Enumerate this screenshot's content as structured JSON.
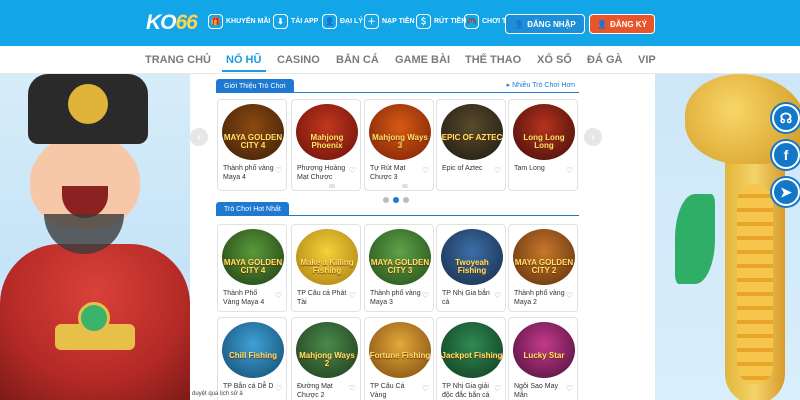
{
  "header": {
    "logo_main": "KO",
    "logo_num": "66",
    "quick_links": [
      {
        "label": "KHUYẾN MÃI",
        "icon": "gift-icon",
        "glyph": "🎁"
      },
      {
        "label": "TẢI APP",
        "icon": "download-icon",
        "glyph": "⬇"
      },
      {
        "label": "ĐẠI LÝ",
        "icon": "agent-icon",
        "glyph": "👤"
      },
      {
        "label": "NẠP TIỀN",
        "icon": "deposit-icon",
        "glyph": "＋"
      },
      {
        "label": "RÚT TIỀN",
        "icon": "withdraw-icon",
        "glyph": "＄"
      },
      {
        "label": "CHƠI THỬ",
        "icon": "gamepad-icon",
        "glyph": "🎮"
      }
    ],
    "login_label": "ĐĂNG NHẬP",
    "register_label": "ĐĂNG KÝ"
  },
  "nav": {
    "items": [
      "TRANG CHỦ",
      "NỔ HŨ",
      "CASINO",
      "BẮN CÁ",
      "GAME BÀI",
      "THỂ THAO",
      "XỔ SỐ",
      "ĐÁ GÀ",
      "VIP"
    ],
    "active_index": 1
  },
  "section1": {
    "title": "Giới Thiệu Trò Chơi",
    "more_link": "Nhiều Trò Chơi Hơn",
    "cards": [
      {
        "name": "Thành phố vàng Maya 4",
        "art": "MAYA GOLDEN CITY 4",
        "plays": ""
      },
      {
        "name": "Phượng Hoàng Mạt Chược",
        "art": "Mahjong Phoenix",
        "plays": "60"
      },
      {
        "name": "Tự Rút Mạt Chược 3",
        "art": "Mahjong Ways 3",
        "plays": "66"
      },
      {
        "name": "Epic of Aztec",
        "art": "EPIC OF AZTEC",
        "plays": ""
      },
      {
        "name": "Tam Long",
        "art": "Long Long Long",
        "plays": ""
      }
    ]
  },
  "section2": {
    "title": "Trò Chơi Hot Nhất",
    "cards": [
      {
        "name": "Thành Phố Vàng Maya 4",
        "art": "MAYA GOLDEN CITY 4"
      },
      {
        "name": "TP Câu cá Phát Tài",
        "art": "Make a Killing Fishing"
      },
      {
        "name": "Thành phố vàng Maya 3",
        "art": "MAYA GOLDEN CITY 3"
      },
      {
        "name": "TP Nhị Gia bắn cá",
        "art": "Twoyeah Fishing"
      },
      {
        "name": "Thành phố vàng Maya 2",
        "art": "MAYA GOLDEN CITY 2"
      },
      {
        "name": "TP Bắn cá Dễ D",
        "art": "Chill Fishing"
      },
      {
        "name": "Đường Mạt Chược 2",
        "art": "Mahjong Ways 2"
      },
      {
        "name": "TP Câu Cá Vàng",
        "art": "Fortune Fishing"
      },
      {
        "name": "TP Nhị Gia giải độc đắc bắn cá",
        "art": "Jackpot Fishing"
      },
      {
        "name": "Ngôi Sao May Mắn",
        "art": "Lucky Star"
      }
    ]
  },
  "ticker": "duyệt qua lịch sử ả",
  "social": [
    {
      "icon": "headset-icon",
      "glyph": "☊"
    },
    {
      "icon": "facebook-icon",
      "glyph": "f"
    },
    {
      "icon": "telegram-icon",
      "glyph": "➤"
    }
  ],
  "colors": {
    "header_blue": "#12a6e8",
    "accent_blue": "#1e7ad0",
    "register_orange": "#e8552a"
  }
}
